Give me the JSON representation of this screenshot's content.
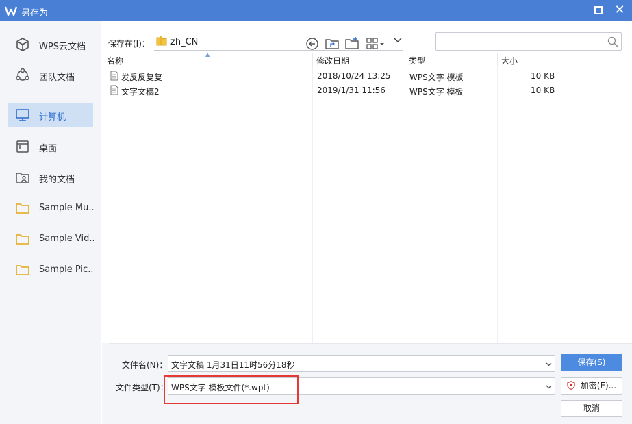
{
  "window": {
    "title": "另存为"
  },
  "sidebar": {
    "items": [
      {
        "label": "WPS云文档",
        "icon": "cube-icon"
      },
      {
        "label": "团队文档",
        "icon": "team-icon"
      },
      {
        "label": "计算机",
        "icon": "monitor-icon",
        "active": true
      },
      {
        "label": "桌面",
        "icon": "desktop-icon"
      },
      {
        "label": "我的文档",
        "icon": "user-folder-icon"
      },
      {
        "label": "Sample Mu...",
        "icon": "folder-icon"
      },
      {
        "label": "Sample Vid...",
        "icon": "folder-icon"
      },
      {
        "label": "Sample Pic...",
        "icon": "folder-icon"
      }
    ]
  },
  "location": {
    "label": "保存在(I)：",
    "value": "zh_CN"
  },
  "search": {
    "placeholder": ""
  },
  "file_list": {
    "columns": [
      "名称",
      "修改日期",
      "类型",
      "大小"
    ],
    "rows": [
      {
        "name": "发反反复复",
        "date": "2018/10/24 13:25",
        "type": "WPS文字 模板",
        "size": "10 KB"
      },
      {
        "name": "文字文稿2",
        "date": "2019/1/31 11:56",
        "type": "WPS文字 模板",
        "size": "10 KB"
      }
    ]
  },
  "form": {
    "filename_label": "文件名(N)：",
    "filename_value": "文字文稿  1月31日11时56分18秒",
    "filetype_label": "文件类型(T)：",
    "filetype_value": "WPS文字 模板文件(*.wpt)",
    "save_button": "保存(S)",
    "encrypt_button": "加密(E)...",
    "cancel_button": "取消"
  },
  "colors": {
    "titlebar": "#4a7fd6",
    "accent": "#4d8be0",
    "highlight_border": "#e53935",
    "sidebar_bg": "#f3f5f8",
    "active_item": "#cfe0f4"
  }
}
